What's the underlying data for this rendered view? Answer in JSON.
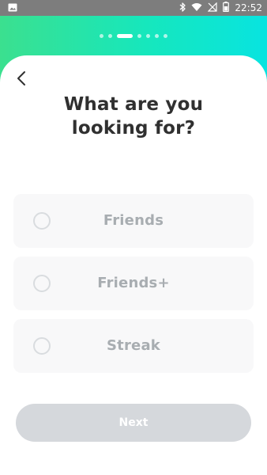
{
  "status_bar": {
    "time": "22:52"
  },
  "onboarding": {
    "progress": {
      "total_steps": 7,
      "current_step": 3
    },
    "question_title": "What are you\nlooking for?",
    "options": [
      {
        "label": "Friends",
        "selected": false
      },
      {
        "label": "Friends+",
        "selected": false
      },
      {
        "label": "Streak",
        "selected": false
      }
    ],
    "next_label": "Next",
    "next_enabled": false
  },
  "colors": {
    "gradient_start": "#3BE08F",
    "gradient_end": "#08E4E0",
    "title_text": "#303030",
    "option_background": "#F8F8F9",
    "option_text": "#A8ADB1",
    "radio_border": "#D9DCDF",
    "disabled_button": "#D5D8DC"
  },
  "icons": {
    "status_left": "image-icon",
    "status_right": [
      "bluetooth-icon",
      "wifi-icon",
      "no-signal-icon",
      "battery-icon"
    ],
    "back": "chevron-left-icon"
  }
}
